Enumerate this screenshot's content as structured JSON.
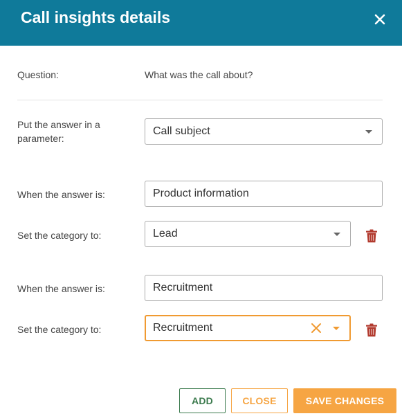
{
  "dialog": {
    "title": "Call insights details",
    "question_label": "Question:",
    "question_value": "What was the call about?",
    "parameter_label_line1": "Put the answer in a",
    "parameter_label_line2": "parameter:",
    "parameter_value": "Call subject"
  },
  "rules": [
    {
      "answer_label": "When the answer is:",
      "answer_value": "Product information",
      "category_label": "Set the category to:",
      "category_value": "Lead"
    },
    {
      "answer_label": "When the answer is:",
      "answer_value": "Recruitment",
      "category_label": "Set the category to:",
      "category_value": "Recruitment"
    }
  ],
  "buttons": {
    "add": "ADD",
    "close": "CLOSE",
    "save": "SAVE CHANGES"
  },
  "colors": {
    "header": "#0f7a9a",
    "focus": "#f09a31",
    "add": "#3b7a4d",
    "accent": "#f6a543",
    "trash": "#b23a2e"
  },
  "icons": {
    "close": "close-icon",
    "trash": "trash-icon",
    "dropdown": "chevron-down-icon",
    "clear": "clear-icon"
  }
}
